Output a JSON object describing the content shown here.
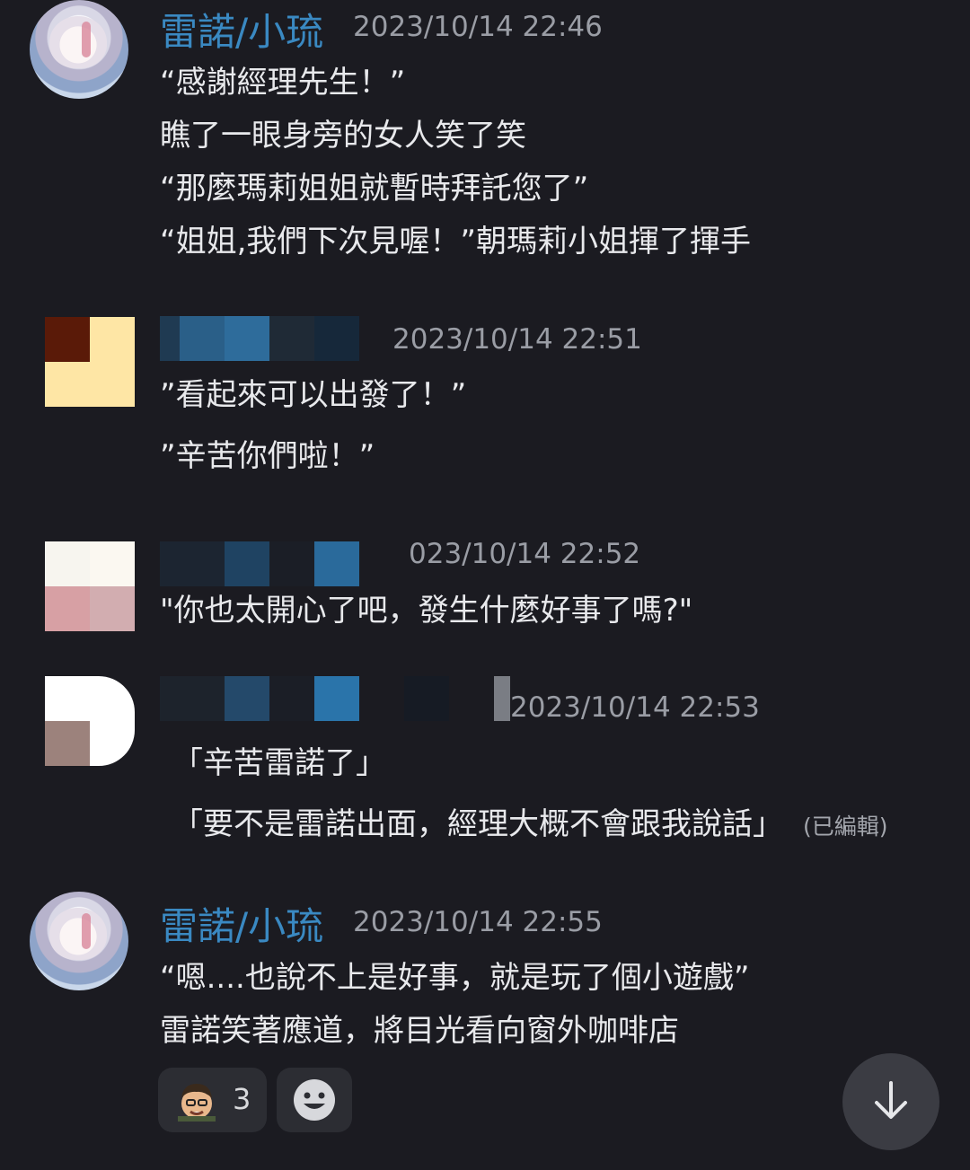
{
  "messages": [
    {
      "author": "雷諾/小琉",
      "timestamp": "2023/10/14 22:46",
      "lines": [
        "“感謝經理先生！”",
        "瞧了一眼身旁的女人笑了笑",
        "“那麼瑪莉姐姐就暫時拜託您了”",
        "“姐姐,我們下次見喔！”朝瑪莉小姐揮了揮手"
      ]
    },
    {
      "author": "",
      "timestamp": "2023/10/14 22:51",
      "lines": [
        "”看起來可以出發了！”",
        "”辛苦你們啦！”"
      ]
    },
    {
      "author": "",
      "timestamp": "023/10/14 22:52",
      "lines": [
        "\"你也太開心了吧，發生什麼好事了嗎?\""
      ]
    },
    {
      "author": "",
      "timestamp": "2023/10/14 22:53",
      "lines": [
        "「辛苦雷諾了」",
        "「要不是雷諾出面，經理大概不會跟我說話」"
      ],
      "edited_label": "(已編輯)"
    },
    {
      "author": "雷諾/小琉",
      "timestamp": "2023/10/14 22:55",
      "lines": [
        "“嗯....也說不上是好事，就是玩了個小遊戲”",
        "雷諾笑著應道，將目光看向窗外咖啡店"
      ]
    }
  ],
  "reactions": [
    {
      "icon": "user-face-emoji-icon",
      "count": "3"
    },
    {
      "icon": "add-reaction-smiley-icon"
    }
  ],
  "scroll_button": {
    "icon": "arrow-down-icon"
  },
  "colors": {
    "background": "#1b1b21",
    "author_blue": "#3a89c2",
    "timestamp": "#9a9da5"
  }
}
